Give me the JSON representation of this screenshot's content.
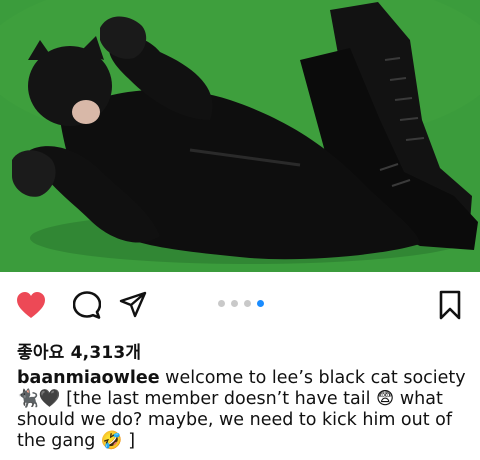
{
  "post": {
    "photo_alt": "photo",
    "colors": {
      "background": "#3ea03c",
      "suit": "#0d0d0d",
      "like_heart": "#ed4956",
      "dot_active": "#1a8cff",
      "dot_inactive": "#c9c9c9"
    },
    "carousel": {
      "count": 4,
      "active_index": 3
    },
    "likes_label": "좋아요 4,313개",
    "caption": {
      "username": "baanmiaowlee",
      "line1_text": " welcome to lee’s black cat society",
      "line2": "🐈‍⬛🖤 [the last member doesn’t have tail 😨 what",
      "line3": "should we do? maybe, we need to kick him out of",
      "line4": "the gang 🤣 ]"
    },
    "icons": {
      "like": "heart-filled-icon",
      "comment": "comment-bubble-icon",
      "share": "paper-plane-icon",
      "save": "bookmark-icon"
    }
  }
}
